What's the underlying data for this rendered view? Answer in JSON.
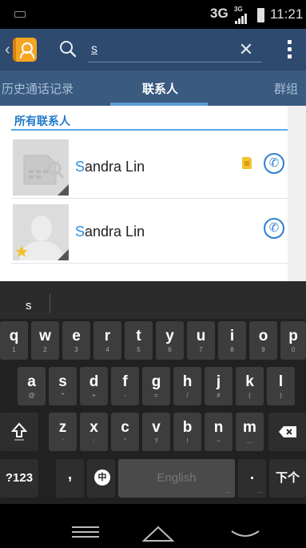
{
  "status_bar": {
    "network": "3G",
    "network_small": "3G",
    "time": "11:21"
  },
  "action_bar": {
    "search_value": "s",
    "icons": [
      "back-chevron-icon",
      "contacts-app-icon",
      "search-icon",
      "close-icon",
      "overflow-menu-icon"
    ]
  },
  "tabs": [
    {
      "label": "历史通话记录",
      "active": false
    },
    {
      "label": "联系人",
      "active": true
    },
    {
      "label": "群组",
      "active": false
    }
  ],
  "section": {
    "header": "所有联系人"
  },
  "contacts": [
    {
      "name_highlight": "S",
      "name_rest": "andra Lin",
      "avatar": "sim-card-avatar",
      "sim_badge": true,
      "starred": false
    },
    {
      "name_highlight": "S",
      "name_rest": "andra Lin",
      "avatar": "person-silhouette-avatar",
      "sim_badge": false,
      "starred": true
    }
  ],
  "keyboard": {
    "suggestion": "s",
    "row1": [
      {
        "key": "q",
        "num": "1"
      },
      {
        "key": "w",
        "num": "2"
      },
      {
        "key": "e",
        "num": "3"
      },
      {
        "key": "r",
        "num": "4"
      },
      {
        "key": "t",
        "num": "5"
      },
      {
        "key": "y",
        "num": "6"
      },
      {
        "key": "u",
        "num": "7"
      },
      {
        "key": "i",
        "num": "8"
      },
      {
        "key": "o",
        "num": "9"
      },
      {
        "key": "p",
        "num": "0"
      }
    ],
    "row2": [
      {
        "key": "a",
        "sym": "@"
      },
      {
        "key": "s",
        "sym": "*"
      },
      {
        "key": "d",
        "sym": "+"
      },
      {
        "key": "f",
        "sym": "-"
      },
      {
        "key": "g",
        "sym": "="
      },
      {
        "key": "h",
        "sym": "/"
      },
      {
        "key": "j",
        "sym": "#"
      },
      {
        "key": "k",
        "sym": "("
      },
      {
        "key": "l",
        "sym": ")"
      }
    ],
    "row3": [
      {
        "key": "z",
        "sym": "'"
      },
      {
        "key": "x",
        "sym": ":"
      },
      {
        "key": "c",
        "sym": "\""
      },
      {
        "key": "v",
        "sym": "?"
      },
      {
        "key": "b",
        "sym": "!"
      },
      {
        "key": "n",
        "sym": "~"
      },
      {
        "key": "m",
        "sym": "…"
      }
    ],
    "symbols_label": "?123",
    "comma": ",",
    "lang_icon_label": "中",
    "space_label": "English",
    "period": ".",
    "enter_label": "下个"
  },
  "colors": {
    "action_bar": "#2e4a6e",
    "tab_bar": "#3a5a80",
    "accent": "#2f8ee0",
    "keyboard_bg": "#212121"
  }
}
